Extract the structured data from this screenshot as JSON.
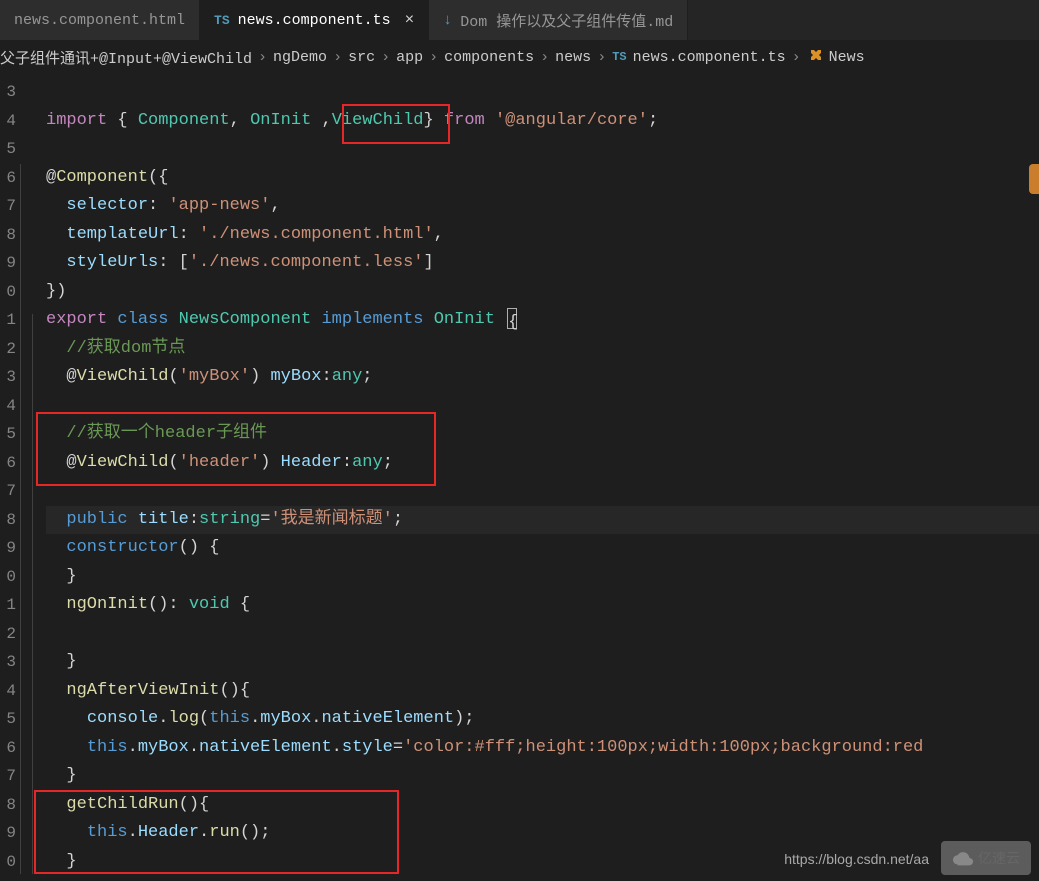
{
  "tabs": [
    {
      "icon": "",
      "label": "news.component.html",
      "active": false
    },
    {
      "icon": "TS",
      "label": "news.component.ts",
      "active": true,
      "close": "×"
    },
    {
      "icon": "↓",
      "label": "Dom 操作以及父子组件传值.md",
      "active": false
    }
  ],
  "breadcrumbs": {
    "parts": [
      "父子组件通讯+@Input+@ViewChild",
      "ngDemo",
      "src",
      "app",
      "components",
      "news",
      "news.component.ts",
      "News"
    ],
    "fileIcon": "TS",
    "classIcon": "⬡",
    "sep": "›"
  },
  "lineNumbers": [
    "3",
    "4",
    "5",
    "6",
    "7",
    "8",
    "9",
    "0",
    "1",
    "2",
    "3",
    "4",
    "5",
    "6",
    "7",
    "8",
    "9",
    "0",
    "1",
    "2",
    "3",
    "4",
    "5",
    "6",
    "7",
    "8",
    "9",
    "0"
  ],
  "code": {
    "l1_import": "import",
    "l1_component": "Component",
    "l1_oninit": "OnInit",
    "l1_viewchild": "ViewChild",
    "l1_from": "from",
    "l1_pkg": "'@angular/core'",
    "l3_at": "@",
    "l3_component": "Component",
    "l4_selector": "selector",
    "l4_val": "'app-news'",
    "l5_templateUrl": "templateUrl",
    "l5_val": "'./news.component.html'",
    "l6_styleUrls": "styleUrls",
    "l6_val": "'./news.component.less'",
    "l8_export": "export",
    "l8_class": "class",
    "l8_name": "NewsComponent",
    "l8_implements": "implements",
    "l8_oninit": "OnInit",
    "l9_comment": "//获取dom节点",
    "l10_viewchild": "ViewChild",
    "l10_arg": "'myBox'",
    "l10_var": "myBox",
    "l10_type": "any",
    "l12_comment": "//获取一个header子组件",
    "l13_viewchild": "ViewChild",
    "l13_arg": "'header'",
    "l13_var": "Header",
    "l13_type": "any",
    "l15_public": "public",
    "l15_var": "title",
    "l15_type": "string",
    "l15_val": "'我是新闻标题'",
    "l16_constructor": "constructor",
    "l18_ngOnInit": "ngOnInit",
    "l18_void": "void",
    "l21_ngAfterViewInit": "ngAfterViewInit",
    "l22_console": "console",
    "l22_log": "log",
    "l22_this": "this",
    "l22_mybox": "myBox",
    "l22_native": "nativeElement",
    "l23_this": "this",
    "l23_mybox": "myBox",
    "l23_native": "nativeElement",
    "l23_style": "style",
    "l23_val": "'color:#fff;height:100px;width:100px;background:red",
    "l25_getChildRun": "getChildRun",
    "l26_this": "this",
    "l26_header": "Header",
    "l26_run": "run"
  },
  "watermark_url": "https://blog.csdn.net/aa",
  "logo_text": "亿速云"
}
